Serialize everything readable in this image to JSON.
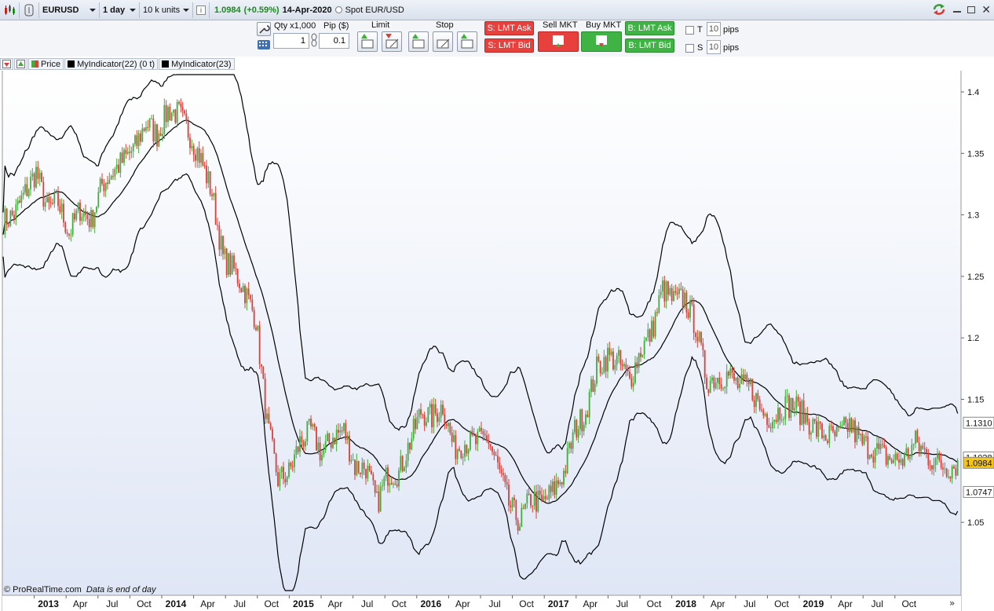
{
  "toolbar": {
    "symbol": "EURUSD",
    "timeframe": "1 day",
    "units": "10 k units",
    "info_icon": "i",
    "price": "1.0984",
    "change": "(+0.59%)",
    "date": "14-Apr-2020",
    "spot_label": "Spot EUR/USD",
    "price_color": "#1a8a1a"
  },
  "trade": {
    "qty_label": "Qty x1,000",
    "qty_value": "1",
    "pip_label": "Pip ($)",
    "pip_value": "0.1",
    "limit_label": "Limit",
    "stop_label": "Stop",
    "s_lmt_ask": "S: LMT Ask",
    "s_lmt_bid": "S: LMT Bid",
    "sell_mkt": "Sell MKT",
    "buy_mkt": "Buy MKT",
    "b_lmt_ask": "B: LMT Ask",
    "b_lmt_bid": "B: LMT Bid",
    "t_label": "T",
    "s_label": "S",
    "t_pips": "10",
    "s_pips": "10",
    "pips_unit": "pips"
  },
  "legend": {
    "price": "Price",
    "ind1": "MyIndicator(22) (0 t)",
    "ind2": "MyIndicator(23)"
  },
  "footer": {
    "copyright": "© ProRealTime.com",
    "note": "Data is end of day"
  },
  "colors": {
    "up": "#3fae3a",
    "down": "#d9403a",
    "band": "#000000",
    "bg_top": "#ffffff",
    "bg_bottom": "#dfe6f5",
    "label_current": "#f5c518"
  },
  "chart_data": {
    "type": "candlestick",
    "symbol": "EURUSD",
    "ylim": [
      1.02,
      1.42
    ],
    "y_ticks": [
      1.05,
      1.1,
      1.15,
      1.2,
      1.25,
      1.3,
      1.35,
      1.4
    ],
    "y_tick_labels": [
      "1.05",
      "",
      "1.15",
      "1.2",
      "1.25",
      "1.3",
      "1.35",
      "1.4"
    ],
    "price_labels": [
      {
        "value": 1.131,
        "text": "1.1310",
        "highlight": false
      },
      {
        "value": 1.1028,
        "text": "1.1028",
        "highlight": false
      },
      {
        "value": 1.0984,
        "text": "1.0984",
        "highlight": true
      },
      {
        "value": 1.0747,
        "text": "1.0747",
        "highlight": false
      }
    ],
    "x_labels": [
      "2013",
      "Apr",
      "Jul",
      "Oct",
      "2014",
      "Apr",
      "Jul",
      "Oct",
      "2015",
      "Apr",
      "Jul",
      "Oct",
      "2016",
      "Apr",
      "Jul",
      "Oct",
      "2017",
      "Apr",
      "Jul",
      "Oct",
      "2018",
      "Apr",
      "Jul",
      "Oct",
      "2019",
      "Apr",
      "Jul",
      "Oct"
    ],
    "x_bold": [
      "2013",
      "2014",
      "2015",
      "2016",
      "2017",
      "2018",
      "2019"
    ],
    "x_range": [
      "2012-10",
      "2020-04"
    ],
    "monthly_close": [
      1.295,
      1.3,
      1.318,
      1.335,
      1.305,
      1.31,
      1.285,
      1.305,
      1.295,
      1.325,
      1.335,
      1.345,
      1.355,
      1.375,
      1.365,
      1.385,
      1.382,
      1.365,
      1.345,
      1.318,
      1.265,
      1.255,
      1.238,
      1.215,
      1.13,
      1.085,
      1.09,
      1.115,
      1.125,
      1.105,
      1.12,
      1.125,
      1.095,
      1.095,
      1.065,
      1.09,
      1.09,
      1.115,
      1.14,
      1.135,
      1.145,
      1.11,
      1.115,
      1.115,
      1.12,
      1.095,
      1.065,
      1.05,
      1.07,
      1.065,
      1.075,
      1.09,
      1.125,
      1.14,
      1.175,
      1.185,
      1.18,
      1.165,
      1.19,
      1.205,
      1.24,
      1.23,
      1.232,
      1.21,
      1.165,
      1.168,
      1.17,
      1.16,
      1.16,
      1.14,
      1.135,
      1.145,
      1.145,
      1.135,
      1.125,
      1.12,
      1.12,
      1.13,
      1.115,
      1.11,
      1.105,
      1.1,
      1.102,
      1.115,
      1.105,
      1.098,
      1.095,
      1.098
    ],
    "series": [
      {
        "name": "Price",
        "type": "candlestick"
      },
      {
        "name": "MyIndicator(22) (0 t)",
        "type": "line"
      },
      {
        "name": "MyIndicator(23)",
        "type": "band"
      }
    ],
    "grid": false
  }
}
